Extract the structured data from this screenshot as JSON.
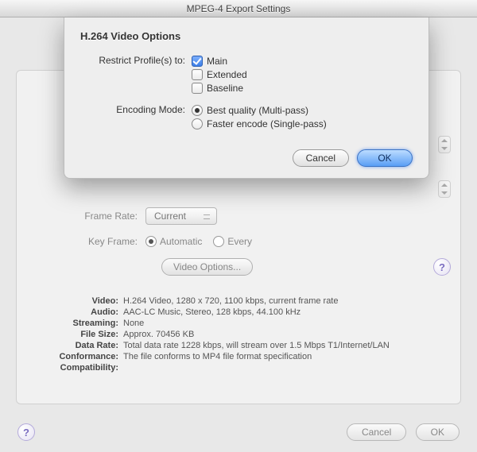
{
  "window": {
    "title": "MPEG-4 Export Settings"
  },
  "sheet": {
    "title": "H.264 Video Options",
    "restrict_label": "Restrict Profile(s) to:",
    "profiles": {
      "main": {
        "label": "Main",
        "checked": true
      },
      "extended": {
        "label": "Extended",
        "checked": false
      },
      "baseline": {
        "label": "Baseline",
        "checked": false
      }
    },
    "encoding_label": "Encoding Mode:",
    "encoding": {
      "best": {
        "label": "Best quality (Multi-pass)",
        "selected": true
      },
      "faster": {
        "label": "Faster encode (Single-pass)",
        "selected": false
      }
    },
    "buttons": {
      "cancel": "Cancel",
      "ok": "OK"
    }
  },
  "main": {
    "frame_rate_label": "Frame Rate:",
    "frame_rate_value": "Current",
    "key_frame": {
      "label": "Key Frame:",
      "automatic": "Automatic",
      "every": "Every"
    },
    "video_options_btn": "Video Options...",
    "help": "?"
  },
  "summary": {
    "video": {
      "label": "Video:",
      "value": "H.264 Video, 1280 x 720, 1100 kbps, current frame rate"
    },
    "audio": {
      "label": "Audio:",
      "value": "AAC-LC Music, Stereo, 128 kbps, 44.100 kHz"
    },
    "streaming": {
      "label": "Streaming:",
      "value": "None"
    },
    "file_size": {
      "label": "File Size:",
      "value": "Approx. 70456 KB"
    },
    "data_rate": {
      "label": "Data Rate:",
      "value": "Total data rate 1228 kbps, will stream over 1.5 Mbps T1/Internet/LAN"
    },
    "conformance": {
      "label": "Conformance:",
      "value": "The file conforms to MP4 file format specification"
    },
    "compatibility": {
      "label": "Compatibility:",
      "value": ""
    }
  },
  "bottom": {
    "help": "?",
    "cancel": "Cancel",
    "ok": "OK"
  }
}
